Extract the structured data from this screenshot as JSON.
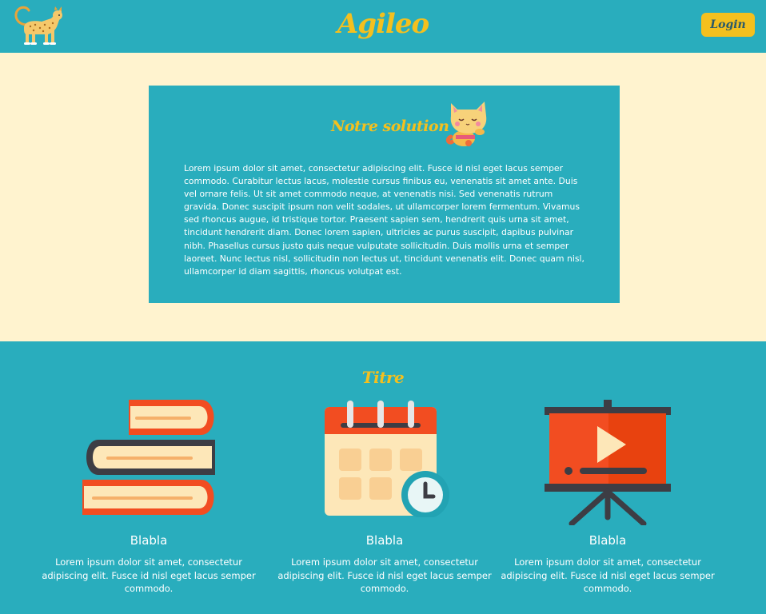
{
  "header": {
    "brand": "Agileo",
    "login_label": "Login",
    "logo_icon": "leopard-icon"
  },
  "solution": {
    "title": "Notre solution",
    "mascot_icon": "cat-icon",
    "text": "Lorem ipsum dolor sit amet, consectetur adipiscing elit. Fusce id nisl eget lacus semper commodo. Curabitur lectus lacus, molestie cursus finibus eu, venenatis sit amet ante. Duis vel ornare felis. Ut sit amet commodo neque, at venenatis nisi. Sed venenatis rutrum gravida. Donec suscipit ipsum non velit sodales, ut ullamcorper lorem fermentum. Vivamus sed rhoncus augue, id tristique tortor. Praesent sapien sem, hendrerit quis urna sit amet, tincidunt hendrerit diam. Donec lorem sapien, ultricies ac purus suscipit, dapibus pulvinar nibh. Phasellus cursus justo quis neque vulputate sollicitudin. Duis mollis urna et semper laoreet. Nunc lectus nisl, sollicitudin non lectus ut, tincidunt venenatis elit. Donec quam nisl, ullamcorper id diam sagittis, rhoncus volutpat est."
  },
  "features": {
    "title": "Titre",
    "items": [
      {
        "icon": "books-icon",
        "name": "Blabla",
        "desc": "Lorem ipsum dolor sit amet, consectetur adipiscing elit. Fusce id nisl eget lacus semper commodo."
      },
      {
        "icon": "calendar-icon",
        "name": "Blabla",
        "desc": "Lorem ipsum dolor sit amet, consectetur adipiscing elit. Fusce id nisl eget lacus semper commodo."
      },
      {
        "icon": "presentation-icon",
        "name": "Blabla",
        "desc": "Lorem ipsum dolor sit amet, consectetur adipiscing elit. Fusce id nisl eget lacus semper commodo."
      }
    ]
  },
  "colors": {
    "teal": "#29adbd",
    "cream": "#fff3cf",
    "accent_yellow": "#f4c01e",
    "orange_red": "#f24d21"
  }
}
